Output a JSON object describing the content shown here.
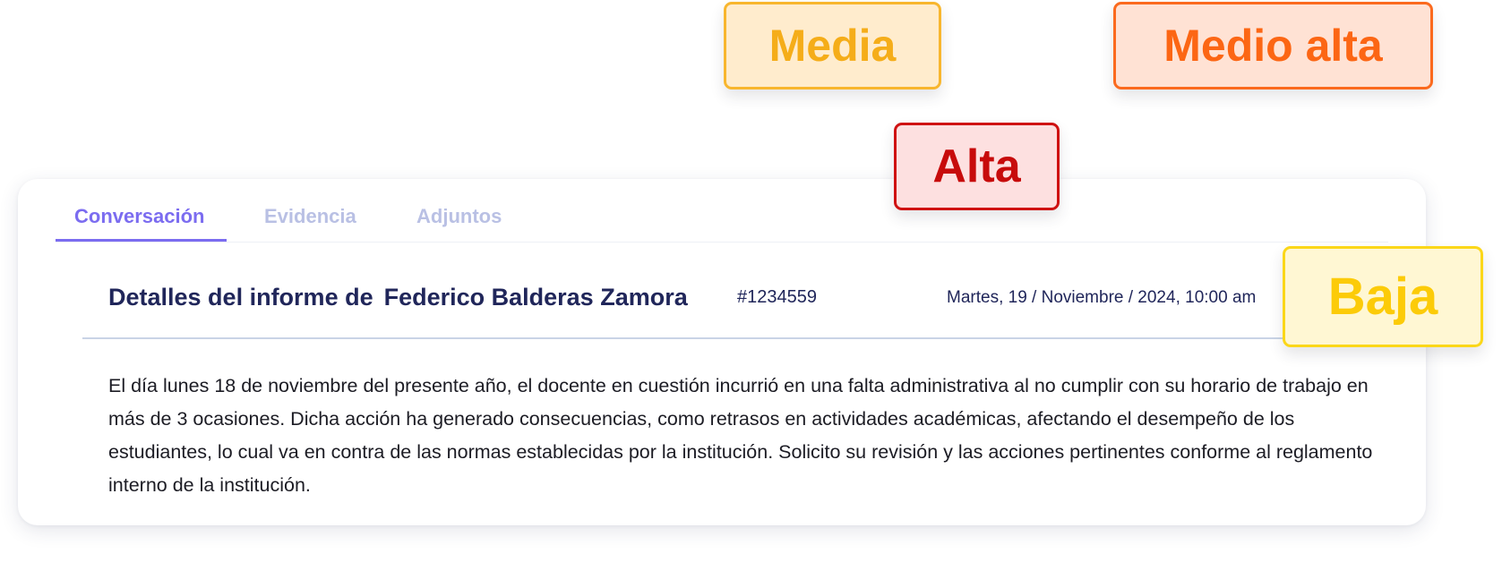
{
  "tabs": [
    {
      "label": "Conversación",
      "active": true
    },
    {
      "label": "Evidencia",
      "active": false
    },
    {
      "label": "Adjuntos",
      "active": false
    }
  ],
  "report": {
    "title_prefix": "Detalles del informe de",
    "person_name": "Federico Balderas Zamora",
    "id": "#1234559",
    "date": "Martes, 19 / Noviembre / 2024, 10:00 am",
    "body": "El día lunes 18 de noviembre del presente año, el docente en cuestión incurrió en una falta administrativa al no cumplir con su horario de trabajo en más de 3 ocasiones. Dicha acción ha generado consecuencias, como retrasos en actividades académicas, afectando el desempeño de los estudiantes, lo cual va en contra de las normas establecidas por la institución. Solicito su revisión y las acciones pertinentes conforme al reglamento interno de la institución."
  },
  "priority_badges": {
    "media": {
      "label": "Media",
      "text_color": "#f5ad19",
      "background": "#ffeccd",
      "border": "#f8b62e"
    },
    "medio_alta": {
      "label": "Medio alta",
      "text_color": "#fc6614",
      "background": "#ffe2d4",
      "border": "#fb6a1e"
    },
    "alta": {
      "label": "Alta",
      "text_color": "#c70b0b",
      "background": "#fde0e0",
      "border": "#cf1212"
    },
    "baja": {
      "label": "Baja",
      "text_color": "#fccb08",
      "background": "#fff7d3",
      "border": "#fbd719"
    }
  },
  "colors": {
    "accent": "#7b6cf0",
    "inactive_tab": "#b9c0e4",
    "heading": "#20265a"
  }
}
